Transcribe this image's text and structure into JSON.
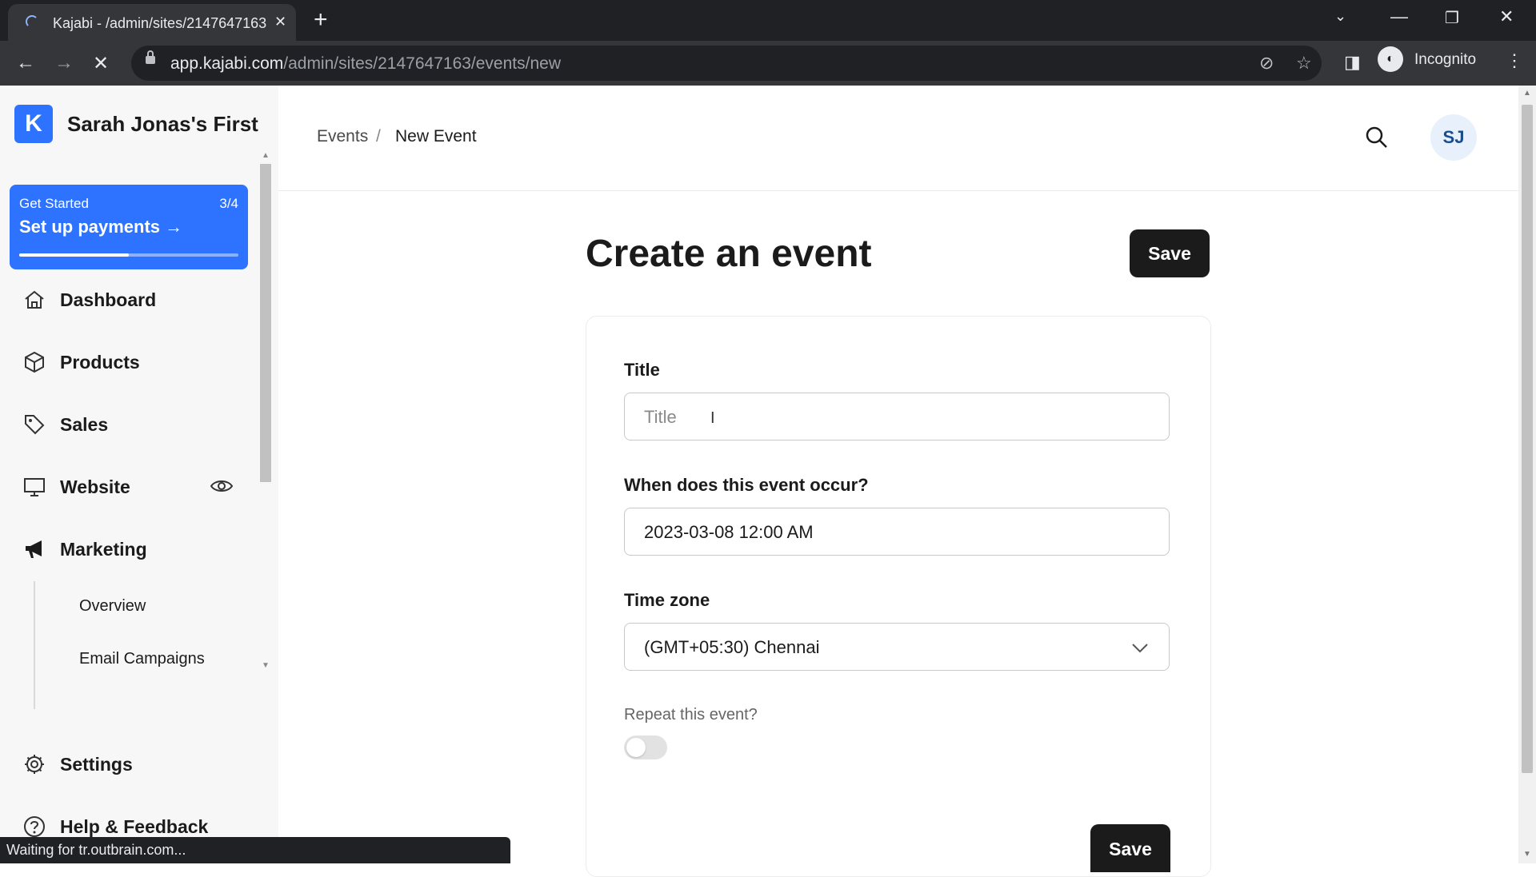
{
  "browser": {
    "tab_title": "Kajabi - /admin/sites/2147647163",
    "url_host": "app.kajabi.com",
    "url_path": "/admin/sites/2147647163/events/new",
    "profile_label": "Incognito",
    "status_text": "Waiting for tr.outbrain.com..."
  },
  "sidebar": {
    "site_name": "Sarah Jonas's First",
    "get_started": {
      "title": "Get Started",
      "count": "3/4",
      "action": "Set up payments",
      "progress": 0.5
    },
    "items": [
      {
        "label": "Dashboard",
        "icon": "home-icon"
      },
      {
        "label": "Products",
        "icon": "box-icon"
      },
      {
        "label": "Sales",
        "icon": "tag-icon"
      },
      {
        "label": "Website",
        "icon": "monitor-icon"
      },
      {
        "label": "Marketing",
        "icon": "megaphone-icon"
      }
    ],
    "marketing_sub": [
      "Overview",
      "Email Campaigns"
    ],
    "bottom": [
      {
        "label": "Settings",
        "icon": "gear-icon"
      },
      {
        "label": "Help & Feedback",
        "icon": "help-icon"
      }
    ]
  },
  "header": {
    "breadcrumb": [
      "Events",
      "/",
      "New Event"
    ],
    "avatar_initials": "SJ"
  },
  "main": {
    "title": "Create an event",
    "save_label": "Save",
    "fields": {
      "title_label": "Title",
      "title_placeholder": "Title",
      "when_label": "When does this event occur?",
      "when_value": "2023-03-08 12:00 AM",
      "tz_label": "Time zone",
      "tz_value": "(GMT+05:30) Chennai",
      "repeat_label": "Repeat this event?",
      "repeat_on": false
    }
  },
  "colors": {
    "accent": "#2e73ff",
    "dark_button": "#1b1b1b"
  }
}
